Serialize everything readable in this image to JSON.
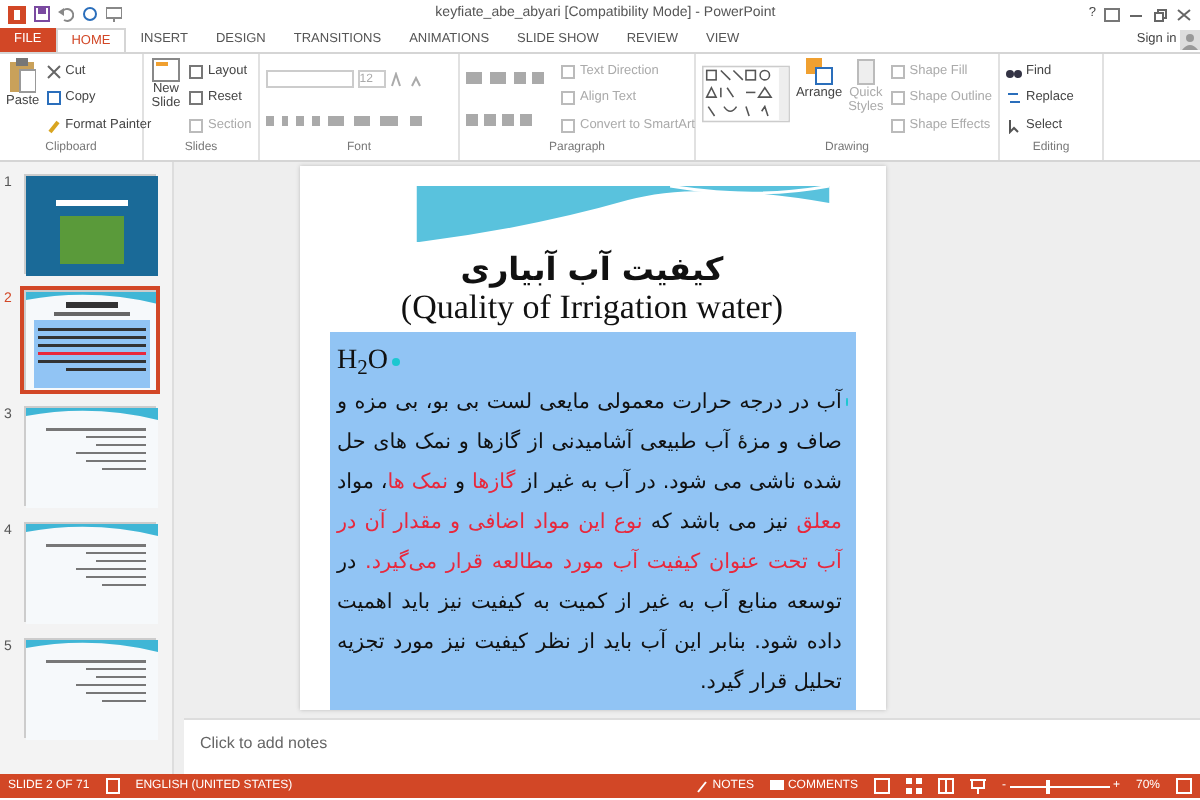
{
  "window": {
    "title": "keyfiate_abe_abyari [Compatibility Mode] - PowerPoint",
    "help": "?",
    "sign_in": "Sign in"
  },
  "tabs": [
    {
      "label": "FILE",
      "kind": "file",
      "selected": false
    },
    {
      "label": "HOME",
      "kind": "tab",
      "selected": true
    },
    {
      "label": "INSERT",
      "kind": "tab",
      "selected": false
    },
    {
      "label": "DESIGN",
      "kind": "tab",
      "selected": false
    },
    {
      "label": "TRANSITIONS",
      "kind": "tab",
      "selected": false
    },
    {
      "label": "ANIMATIONS",
      "kind": "tab",
      "selected": false
    },
    {
      "label": "SLIDE SHOW",
      "kind": "tab",
      "selected": false
    },
    {
      "label": "REVIEW",
      "kind": "tab",
      "selected": false
    },
    {
      "label": "VIEW",
      "kind": "tab",
      "selected": false
    }
  ],
  "ribbon": {
    "clipboard": {
      "label": "Clipboard",
      "paste": "Paste",
      "cut": "Cut",
      "copy": "Copy",
      "format_painter": "Format Painter"
    },
    "slides": {
      "label": "Slides",
      "new_slide": "New Slide",
      "layout": "Layout",
      "reset": "Reset",
      "section": "Section"
    },
    "font": {
      "label": "Font",
      "size": "12"
    },
    "paragraph": {
      "label": "Paragraph",
      "text_direction": "Text Direction",
      "align_text": "Align Text",
      "convert": "Convert to SmartArt"
    },
    "drawing": {
      "label": "Drawing",
      "arrange": "Arrange",
      "quick_styles": "Quick Styles",
      "shape_fill": "Shape Fill",
      "shape_outline": "Shape Outline",
      "shape_effects": "Shape Effects"
    },
    "editing": {
      "label": "Editing",
      "find": "Find",
      "replace": "Replace",
      "select": "Select"
    }
  },
  "thumbnails": [
    {
      "number": "1",
      "kind": "title",
      "selected": false
    },
    {
      "number": "2",
      "kind": "current",
      "selected": true
    },
    {
      "number": "3",
      "kind": "list",
      "selected": false
    },
    {
      "number": "4",
      "kind": "list",
      "selected": false
    },
    {
      "number": "5",
      "kind": "list",
      "selected": false
    }
  ],
  "slide": {
    "title": "کیفیت آب آبیاری",
    "subtitle": "(Quality of Irrigation water)",
    "bullets": [
      {
        "runs": [
          {
            "text": "H$_{2}$O",
            "emphasis": false
          }
        ]
      },
      {
        "runs": [
          {
            "text": "آب در درجه حرارت معمولی مایعی لست  بی بو، بی مزه و صاف و مزهٔ آب طبیعی آشامیدنی از گازها و نمک های حل شده ناشی می شود. در آب به غیر از ",
            "emphasis": false
          },
          {
            "text": "گازها",
            "emphasis": true
          },
          {
            "text": " و ",
            "emphasis": false
          },
          {
            "text": "نمک ها",
            "emphasis": true
          },
          {
            "text": "،  مواد ",
            "emphasis": false
          },
          {
            "text": "معلق",
            "emphasis": true
          },
          {
            "text": " نیز می باشد که ",
            "emphasis": false
          },
          {
            "text": "نوع این مواد اضافی و مقدار آن در آب تحت عنوان کیفیت آب مورد مطالعه قرار می‌گیرد.",
            "emphasis": true
          },
          {
            "text": " در توسعه منابع آب به غیر از کمیت به کیفیت نیز باید اهمیت داده شود. بنابر این آب باید از نظر کیفیت نیز مورد تجزیه تحلیل قرار گیرد.",
            "emphasis": false
          }
        ]
      }
    ]
  },
  "notes": {
    "placeholder": "Click to add notes"
  },
  "status_bar": {
    "slide": "SLIDE 2 OF 71",
    "language": "ENGLISH (UNITED STATES)",
    "notes": "NOTES",
    "comments": "COMMENTS",
    "zoom": "70%",
    "zoom_out": "-",
    "zoom_in": "+",
    "zoom_slider": {
      "level": 0.37
    }
  }
}
